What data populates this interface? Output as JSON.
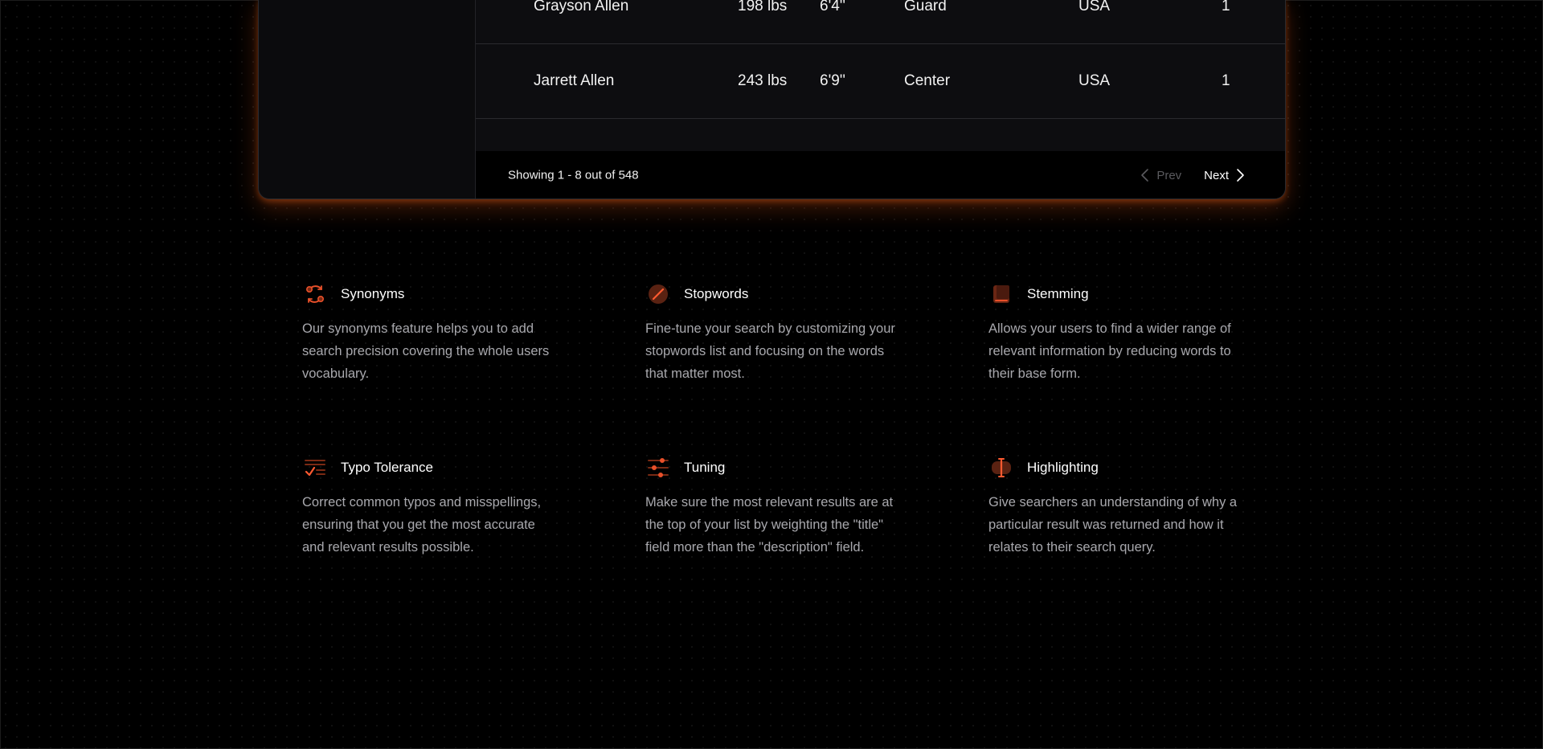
{
  "results_table": {
    "rows": [
      {
        "name": "Grayson Allen",
        "weight": "198 lbs",
        "height": "6'4''",
        "position": "Guard",
        "nationality": "USA",
        "number": "1"
      },
      {
        "name": "Jarrett Allen",
        "weight": "243 lbs",
        "height": "6'9''",
        "position": "Center",
        "nationality": "USA",
        "number": "1"
      }
    ],
    "footer": {
      "showing": "Showing 1 - 8 out of 548",
      "prev_label": "Prev",
      "next_label": "Next"
    }
  },
  "features": [
    {
      "icon": "synonyms-icon",
      "title": "Synonyms",
      "description": "Our synonyms feature helps you to add search precision covering the whole users vocabulary."
    },
    {
      "icon": "stopwords-icon",
      "title": "Stopwords",
      "description": "Fine-tune your search by customizing your stopwords list and focusing on the words that matter most."
    },
    {
      "icon": "stemming-icon",
      "title": "Stemming",
      "description": "Allows your users to find a wider range of relevant information by reducing words to their base form."
    },
    {
      "icon": "typo-tolerance-icon",
      "title": "Typo Tolerance",
      "description": "Correct common typos and misspellings, ensuring that you get the most accurate and relevant results possible."
    },
    {
      "icon": "tuning-icon",
      "title": "Tuning",
      "description": "Make sure the most relevant results are at the top of your list by weighting the \"title\" field more than the \"description\" field."
    },
    {
      "icon": "highlighting-icon",
      "title": "Highlighting",
      "description": "Give searchers an understanding of why a particular result was returned and how it relates to their search query."
    }
  ],
  "colors": {
    "accent": "#e8502a",
    "accent_dark": "#7a2a14",
    "background": "#000000",
    "panel": "#0d0d10",
    "text_muted": "#a8a8ad"
  }
}
